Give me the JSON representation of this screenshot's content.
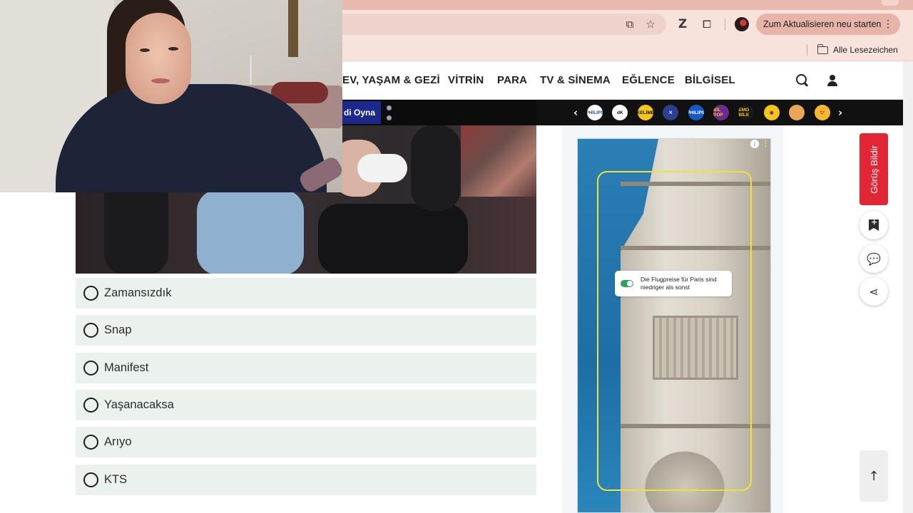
{
  "browser": {
    "restart_label": "Zum Aktualisieren neu starten",
    "restart_menu": "⋮",
    "bookmarks_all": "Alle Lesezeichen",
    "profile_letter": "Z"
  },
  "nav": {
    "items": [
      "EV, YAŞAM & GEZİ",
      "VİTRİN",
      "PARA",
      "TV & SİNEMA",
      "EĞLENCE",
      "BİLGİSEL"
    ]
  },
  "games_bar": {
    "play_label": "di Oyna",
    "prev": "‹",
    "next": "›",
    "icons": [
      {
        "name": "philips-icon",
        "text": "PHILIPS",
        "bg": "#ffffff",
        "fg": "#1b4aa0"
      },
      {
        "name": "dk-icon",
        "text": "dK",
        "bg": "#ffffff",
        "fg": "#111111"
      },
      {
        "name": "kelime-icon",
        "text": "KELİME",
        "bg": "#f5c518",
        "fg": "#111111"
      },
      {
        "name": "pattern-icon",
        "text": "✕",
        "bg": "#2b3e8f",
        "fg": "#ffffff"
      },
      {
        "name": "philips-blue-icon",
        "text": "PHILIPS",
        "bg": "#1559c7",
        "fg": "#ffffff"
      },
      {
        "name": "bil-pop-icon",
        "text": "BİL POP",
        "bg": "#6a2c91",
        "fg": "#f5c518"
      },
      {
        "name": "emo-bile-icon",
        "text": "EMO BİLE",
        "bg": "#1a1a1a",
        "fg": "#f5c518"
      },
      {
        "name": "gamepad-icon",
        "text": "◉",
        "bg": "#f5c518",
        "fg": "#6a2c91"
      },
      {
        "name": "orange-face-icon",
        "text": "",
        "bg": "#e8a65a",
        "fg": "#ffffff"
      },
      {
        "name": "heart-eyes-emoji-icon",
        "text": "😍",
        "bg": "#f7b731",
        "fg": "#d62b2b"
      }
    ]
  },
  "quiz": {
    "options": [
      "Zamansızdık",
      "Snap",
      "Manifest",
      "Yaşanacaksa",
      "Arıyo",
      "KTS"
    ]
  },
  "ad": {
    "info": "i",
    "more": "⋮",
    "toast_text": "Die Flugpreise für Paris sind niedriger als sonst"
  },
  "rail": {
    "feedback_label": "Görüş Bildir",
    "scroll_top": "↑"
  },
  "colors": {
    "feedback_red": "#e32636",
    "option_bg": "#ebf2ee",
    "play_btn": "#1b2a8a"
  }
}
